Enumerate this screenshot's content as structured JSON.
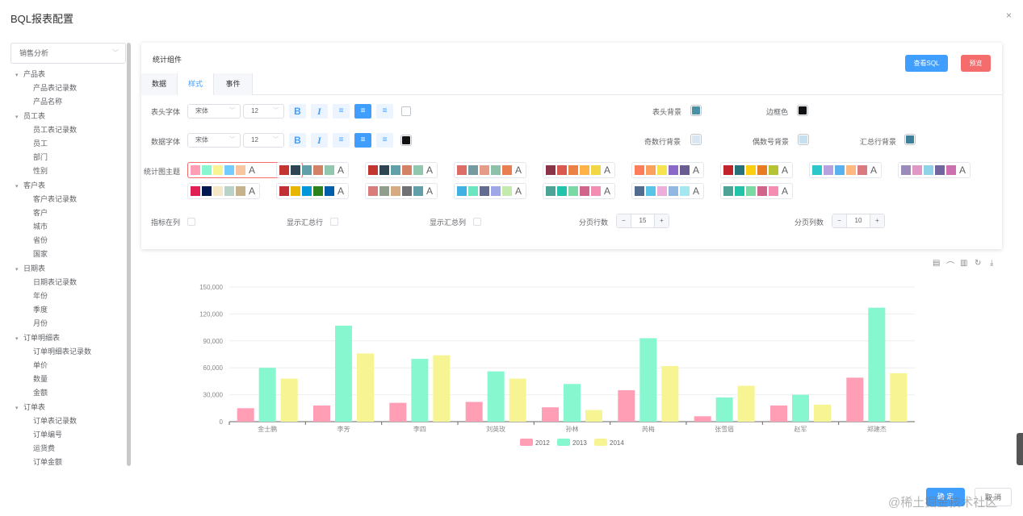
{
  "dialog": {
    "title": "BQL报表配置",
    "close": "×"
  },
  "sidebar": {
    "select": "销售分析",
    "tree": [
      {
        "label": "产品表",
        "children": [
          "产品表记录数",
          "产品名称"
        ]
      },
      {
        "label": "员工表",
        "children": [
          "员工表记录数",
          "员工",
          "部门",
          "性别"
        ]
      },
      {
        "label": "客户表",
        "children": [
          "客户表记录数",
          "客户",
          "城市",
          "省份",
          "国家"
        ]
      },
      {
        "label": "日期表",
        "children": [
          "日期表记录数",
          "年份",
          "季度",
          "月份"
        ]
      },
      {
        "label": "订单明细表",
        "children": [
          "订单明细表记录数",
          "单价",
          "数量",
          "金额"
        ]
      },
      {
        "label": "订单表",
        "children": [
          "订单表记录数",
          "订单编号",
          "运货费",
          "订单金额"
        ]
      }
    ]
  },
  "panel": {
    "title": "统计组件",
    "view_sql": "查看SQL",
    "preview": "预览",
    "tabs": [
      "数据",
      "样式",
      "事件"
    ],
    "header_font_label": "表头字体",
    "data_font_label": "数据字体",
    "font_family": "宋体",
    "font_size": "12",
    "header_bg_label": "表头背景",
    "border_color_label": "边框色",
    "odd_row_bg_label": "奇数行背景",
    "even_row_bg_label": "偶数号背景",
    "summary_row_bg_label": "汇总行背景",
    "chart_theme_label": "统计图主题",
    "metric_in_col_label": "指标在列",
    "show_summary_row_label": "显示汇总行",
    "show_summary_col_label": "显示汇总列",
    "page_rows_label": "分页行数",
    "page_rows": "15",
    "page_cols_label": "分页列数",
    "page_cols": "10",
    "colors": {
      "header_bg": "#4a90a4",
      "border": "#111111",
      "odd_row_bg": "#dbe6f5",
      "even_row_bg": "#c6e0f0",
      "summary_row_bg": "#3e7f9a",
      "data_color": "#111111"
    },
    "themes": [
      [
        "#ff9eb5",
        "#87f7cf",
        "#f7f494",
        "#72ccff",
        "#f7c5a0"
      ],
      [
        "#c23531",
        "#2f4554",
        "#61a0a8",
        "#d48265",
        "#91c7ae"
      ],
      [
        "#c23531",
        "#2f4554",
        "#61a0a8",
        "#d48265",
        "#91c7ae"
      ],
      [
        "#dd6b66",
        "#759aa0",
        "#e69d87",
        "#8dc1a9",
        "#ea7e53"
      ],
      [
        "#893448",
        "#d95850",
        "#eb8146",
        "#ffb248",
        "#f2d643"
      ],
      [
        "#fc7d5b",
        "#fca15d",
        "#f7e34f",
        "#8b69c8",
        "#6a5c91"
      ],
      [
        "#c1232b",
        "#27727b",
        "#fcce10",
        "#e87c25",
        "#b5c334"
      ],
      [
        "#2ec7c9",
        "#b6a2de",
        "#5ab1ef",
        "#ffb980",
        "#d87a80"
      ],
      [
        "#9b8bba",
        "#e098c7",
        "#8fd3e8",
        "#71669e",
        "#cc70af"
      ],
      [
        "#e01f54",
        "#001852",
        "#f5e8c8",
        "#b8d2c7",
        "#c6b38e"
      ],
      [
        "#c12e34",
        "#e6b600",
        "#0098d9",
        "#2b821d",
        "#005eaa"
      ],
      [
        "#d87c7c",
        "#919e8b",
        "#d7ab82",
        "#6e7074",
        "#61a0a8"
      ],
      [
        "#3fb1e3",
        "#6be6c1",
        "#626c91",
        "#a0a7e6",
        "#c4ebad"
      ],
      [
        "#4ea397",
        "#22c3aa",
        "#7bd9a5",
        "#d0648a",
        "#f58db2"
      ],
      [
        "#516b91",
        "#59c4e6",
        "#edafda",
        "#93b7e3",
        "#a5e7f0"
      ],
      [
        "#4ea397",
        "#22c3aa",
        "#7bd9a5",
        "#d0648a",
        "#f58db2"
      ]
    ]
  },
  "toolbox": [
    "data-view-icon",
    "line-chart-icon",
    "bar-chart-icon",
    "restore-icon",
    "download-icon"
  ],
  "footer": {
    "ok": "确 定",
    "cancel": "取 消"
  },
  "watermark": "@稀土掘金技术社区",
  "chart_data": {
    "type": "bar",
    "categories": [
      "金士鹏",
      "李芳",
      "李四",
      "刘英玫",
      "孙林",
      "芮梅",
      "张雪眉",
      "赵军",
      "郑建杰"
    ],
    "series": [
      {
        "name": "2012",
        "values": [
          15000,
          18000,
          21000,
          22000,
          16000,
          35000,
          6000,
          18000,
          49000
        ],
        "color": "#ff9eb5"
      },
      {
        "name": "2013",
        "values": [
          60000,
          107000,
          70000,
          56000,
          42000,
          93000,
          27000,
          30000,
          127000
        ],
        "color": "#87f7cf"
      },
      {
        "name": "2014",
        "values": [
          48000,
          76000,
          74000,
          48000,
          13000,
          62000,
          40000,
          19000,
          54000
        ],
        "color": "#f7f494"
      }
    ],
    "yticks": [
      "0",
      "30,000",
      "60,000",
      "90,000",
      "120,000",
      "150,000"
    ],
    "ylim": [
      0,
      150000
    ],
    "legend": "bottom-center"
  }
}
